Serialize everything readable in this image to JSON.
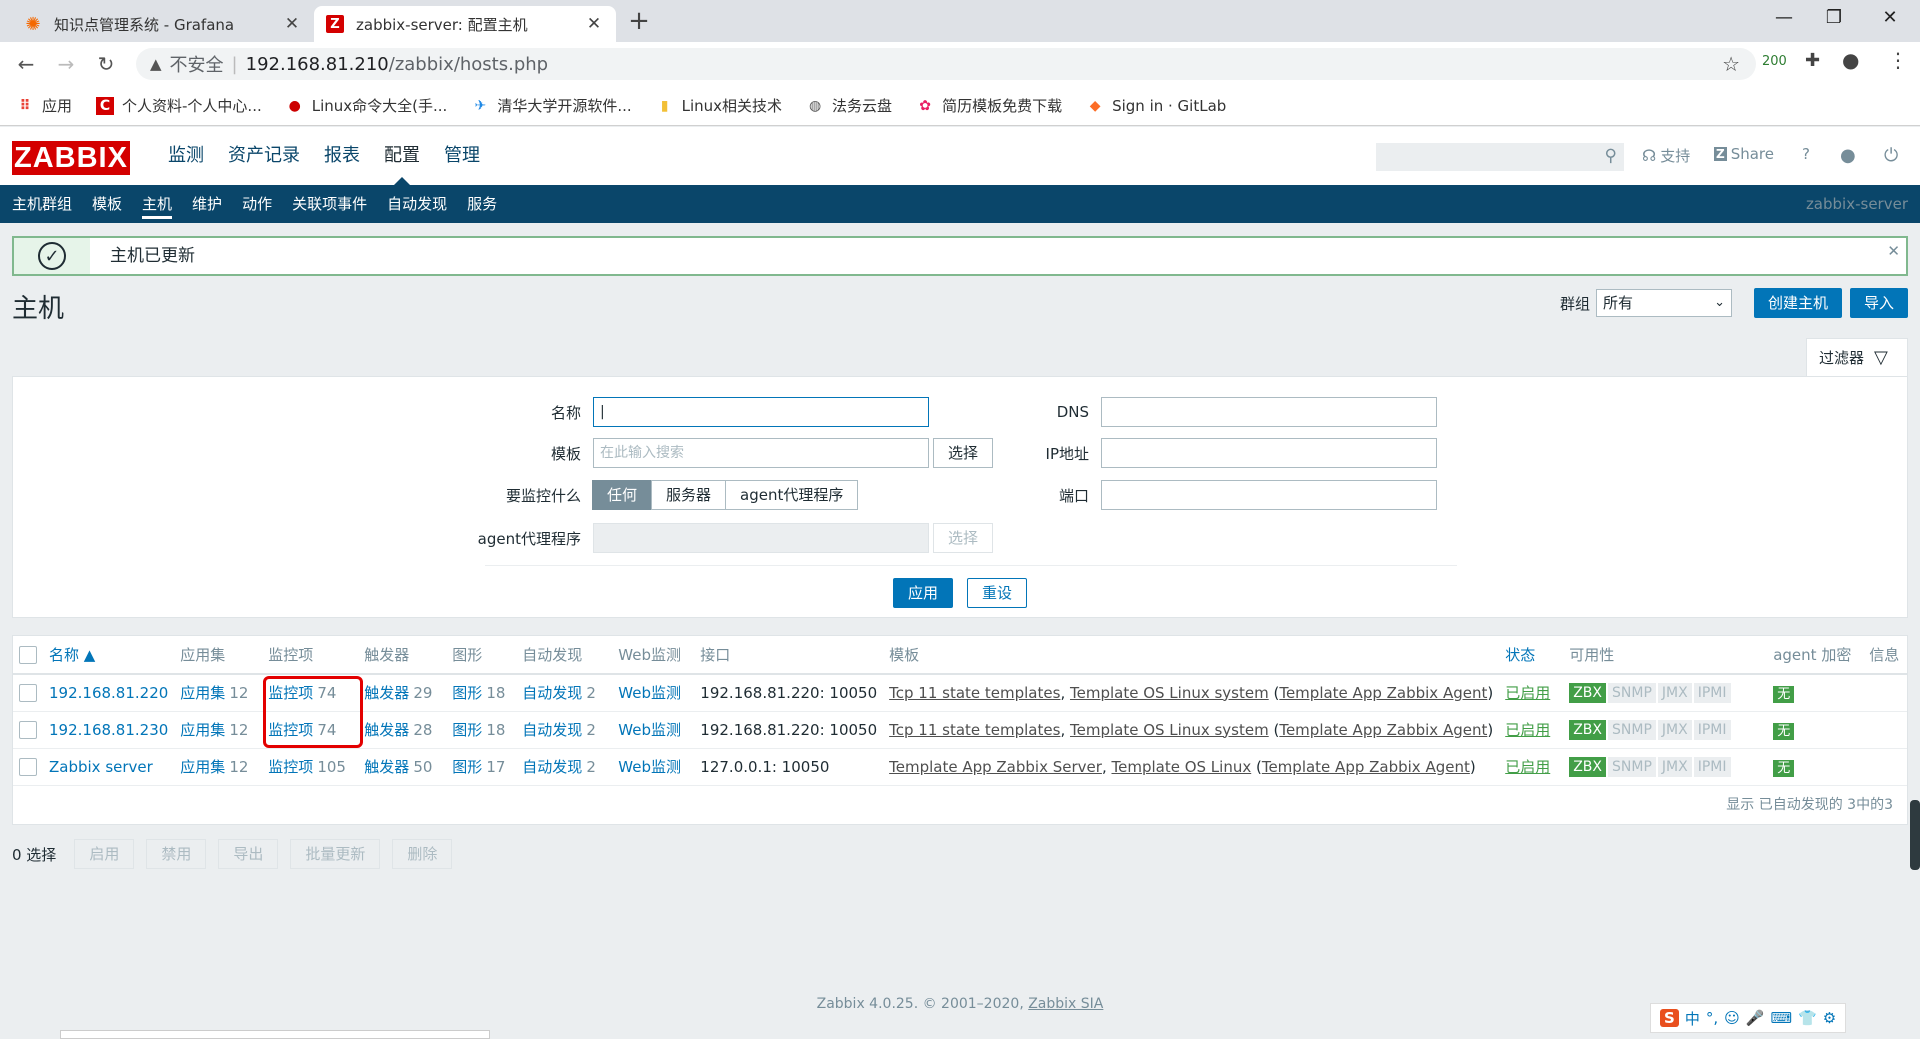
{
  "browser": {
    "tabs": [
      {
        "title": "知识点管理系统 - Grafana",
        "icon": "grafana-icon"
      },
      {
        "title": "zabbix-server: 配置主机",
        "icon": "zabbix-icon"
      }
    ],
    "address": {
      "warning": "不安全",
      "host": "192.168.81.210",
      "path": "/zabbix/hosts.php"
    },
    "ext_badge": "200",
    "bookmarks": [
      "应用",
      "个人资料-个人中心...",
      "Linux命令大全(手...",
      "清华大学开源软件...",
      "Linux相关技术",
      "法务云盘",
      "简历模板免费下载",
      "Sign in · GitLab"
    ]
  },
  "zabbix": {
    "logo": "ZABBIX",
    "menu": [
      "监测",
      "资产记录",
      "报表",
      "配置",
      "管理"
    ],
    "tools": {
      "support": "支持",
      "share": "Share",
      "help": "?"
    },
    "submenu": [
      "主机群组",
      "模板",
      "主机",
      "维护",
      "动作",
      "关联项事件",
      "自动发现",
      "服务"
    ],
    "server": "zabbix-server"
  },
  "message": {
    "text": "主机已更新"
  },
  "page": {
    "title": "主机",
    "group_label": "群组",
    "group_value": "所有",
    "create_btn": "创建主机",
    "import_btn": "导入",
    "filter_tab": "过滤器"
  },
  "filter": {
    "name_label": "名称",
    "template_label": "模板",
    "template_placeholder": "在此输入搜索",
    "select_btn": "选择",
    "monitor_label": "要监控什么",
    "monitor_opts": [
      "任何",
      "服务器",
      "agent代理程序"
    ],
    "proxy_label": "agent代理程序",
    "dns_label": "DNS",
    "ip_label": "IP地址",
    "port_label": "端口",
    "apply": "应用",
    "reset": "重设"
  },
  "table": {
    "headers": [
      "名称 ▲",
      "应用集",
      "监控项",
      "触发器",
      "图形",
      "自动发现",
      "Web监测",
      "接口",
      "模板",
      "状态",
      "可用性",
      "agent 加密",
      "信息"
    ],
    "rows": [
      {
        "name": "192.168.81.220",
        "apps": "应用集",
        "apps_n": "12",
        "items": "监控项",
        "items_n": "74",
        "triggers": "触发器",
        "triggers_n": "29",
        "graphs": "图形",
        "graphs_n": "18",
        "disc": "自动发现",
        "disc_n": "2",
        "web": "Web监测",
        "iface": "192.168.81.220: 10050",
        "t1": "Tcp 11 state templates",
        "t2": "Template OS Linux system",
        "t3": "Template App Zabbix Agent",
        "status": "已启用",
        "enc": "无"
      },
      {
        "name": "192.168.81.230",
        "apps": "应用集",
        "apps_n": "12",
        "items": "监控项",
        "items_n": "74",
        "triggers": "触发器",
        "triggers_n": "28",
        "graphs": "图形",
        "graphs_n": "18",
        "disc": "自动发现",
        "disc_n": "2",
        "web": "Web监测",
        "iface": "192.168.81.220: 10050",
        "t1": "Tcp 11 state templates",
        "t2": "Template OS Linux system",
        "t3": "Template App Zabbix Agent",
        "status": "已启用",
        "enc": "无"
      },
      {
        "name": "Zabbix server",
        "apps": "应用集",
        "apps_n": "12",
        "items": "监控项",
        "items_n": "105",
        "triggers": "触发器",
        "triggers_n": "50",
        "graphs": "图形",
        "graphs_n": "17",
        "disc": "自动发现",
        "disc_n": "2",
        "web": "Web监测",
        "iface": "127.0.0.1: 10050",
        "t1": "Template App Zabbix Server",
        "t2": "Template OS Linux",
        "t3": "Template App Zabbix Agent",
        "status": "已启用",
        "enc": "无"
      }
    ],
    "avail": [
      "ZBX",
      "SNMP",
      "JMX",
      "IPMI"
    ],
    "summary": "显示 已自动发现的 3中的3"
  },
  "actions": {
    "selected": "0 选择",
    "buttons": [
      "启用",
      "禁用",
      "导出",
      "批量更新",
      "删除"
    ]
  },
  "footer": {
    "text": "Zabbix 4.0.25. © 2001–2020,",
    "link": "Zabbix SIA"
  },
  "ime": [
    "S",
    "中",
    "°,",
    "☺",
    "🎤",
    "⌨",
    "👕",
    "⚙"
  ],
  "colors": {
    "brand": "#d40000",
    "nav": "#0a466a",
    "link": "#0275b8",
    "ok": "#429e47",
    "highlight": "#e30000"
  }
}
